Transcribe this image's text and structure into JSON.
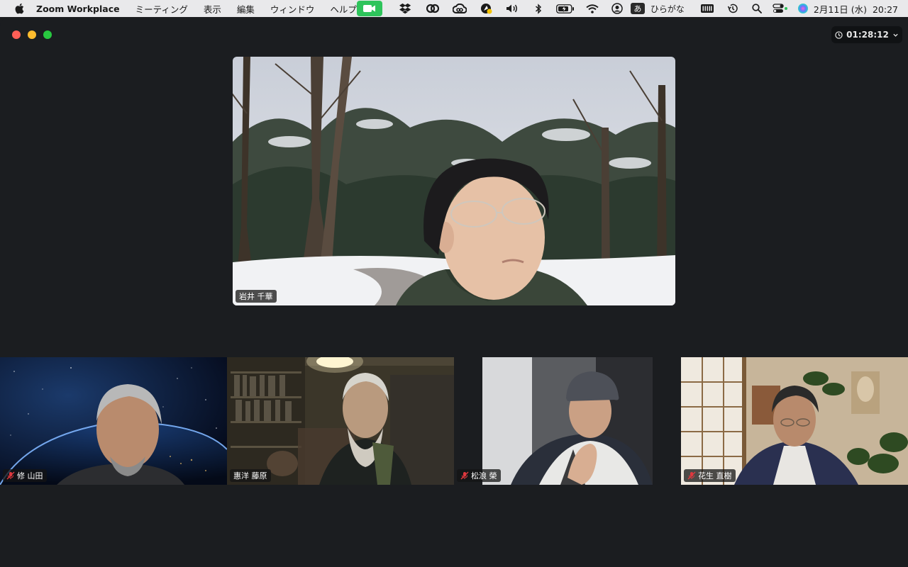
{
  "menubar": {
    "app_name": "Zoom Workplace",
    "menus": [
      "ミーティング",
      "表示",
      "編集",
      "ウィンドウ",
      "ヘルプ"
    ],
    "ime_badge": "あ",
    "ime_label": "ひらがな",
    "date": "2月11日 (水)",
    "time": "20:27",
    "status_icons": [
      "zoom-video-icon",
      "dropbox-icon",
      "webex-icon",
      "creative-cloud-icon",
      "notification-icon",
      "volume-icon",
      "bluetooth-icon",
      "battery-icon",
      "wifi-icon",
      "user-icon",
      "input-method-icon",
      "keyboard-icon",
      "time-machine-icon",
      "search-icon",
      "control-center-icon",
      "siri-icon"
    ]
  },
  "window": {
    "timer": "01:28:12"
  },
  "participants": {
    "main": {
      "name": "岩井 千華",
      "muted": false
    },
    "gallery": [
      {
        "name": "修 山田",
        "muted": true
      },
      {
        "name": "惠洋 藤原",
        "muted": false
      },
      {
        "name": "松浪 榮",
        "muted": true
      },
      {
        "name": "花生 直樹",
        "muted": true
      }
    ]
  },
  "colors": {
    "background": "#1b1d20",
    "zoom_green": "#2ec45b",
    "mute_red": "#e0383e"
  }
}
